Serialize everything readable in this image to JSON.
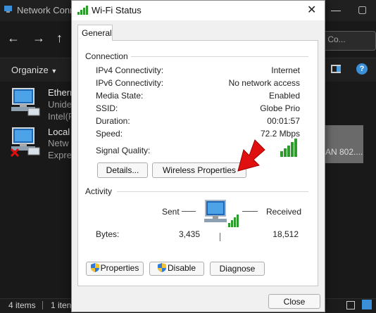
{
  "background_window": {
    "title": "Network Conn",
    "search_placeholder": "k Co...",
    "organize_label": "Organize",
    "items": [
      {
        "name": "Ethern",
        "line1": "Unide",
        "line2": "Intel(F"
      },
      {
        "name": "Local",
        "line1": "Netw",
        "line2": "Expres"
      }
    ],
    "selected_item_text": "AN 802....",
    "status_items": "4 items",
    "status_selected": "1 iten"
  },
  "dialog": {
    "title": "Wi-Fi Status",
    "close_glyph": "✕",
    "tab_general": "General",
    "connection": {
      "heading": "Connection",
      "rows": [
        {
          "label": "IPv4 Connectivity:",
          "value": "Internet"
        },
        {
          "label": "IPv6 Connectivity:",
          "value": "No network access"
        },
        {
          "label": "Media State:",
          "value": "Enabled"
        },
        {
          "label": "SSID:",
          "value": "Globe Prio"
        },
        {
          "label": "Duration:",
          "value": "00:01:57"
        },
        {
          "label": "Speed:",
          "value": "72.2 Mbps"
        }
      ],
      "signal_label": "Signal Quality:",
      "details_button": "Details...",
      "wireless_properties_button": "Wireless Properties"
    },
    "activity": {
      "heading": "Activity",
      "sent_label": "Sent",
      "received_label": "Received",
      "bytes_label": "Bytes:",
      "bytes_sent": "3,435",
      "bytes_received": "18,512"
    },
    "buttons": {
      "properties": "Properties",
      "disable": "Disable",
      "diagnose": "Diagnose",
      "close": "Close"
    }
  },
  "colors": {
    "signal_green": "#2d9c2d",
    "arrow_red": "#e01010",
    "accent_blue": "#1a73d6"
  }
}
